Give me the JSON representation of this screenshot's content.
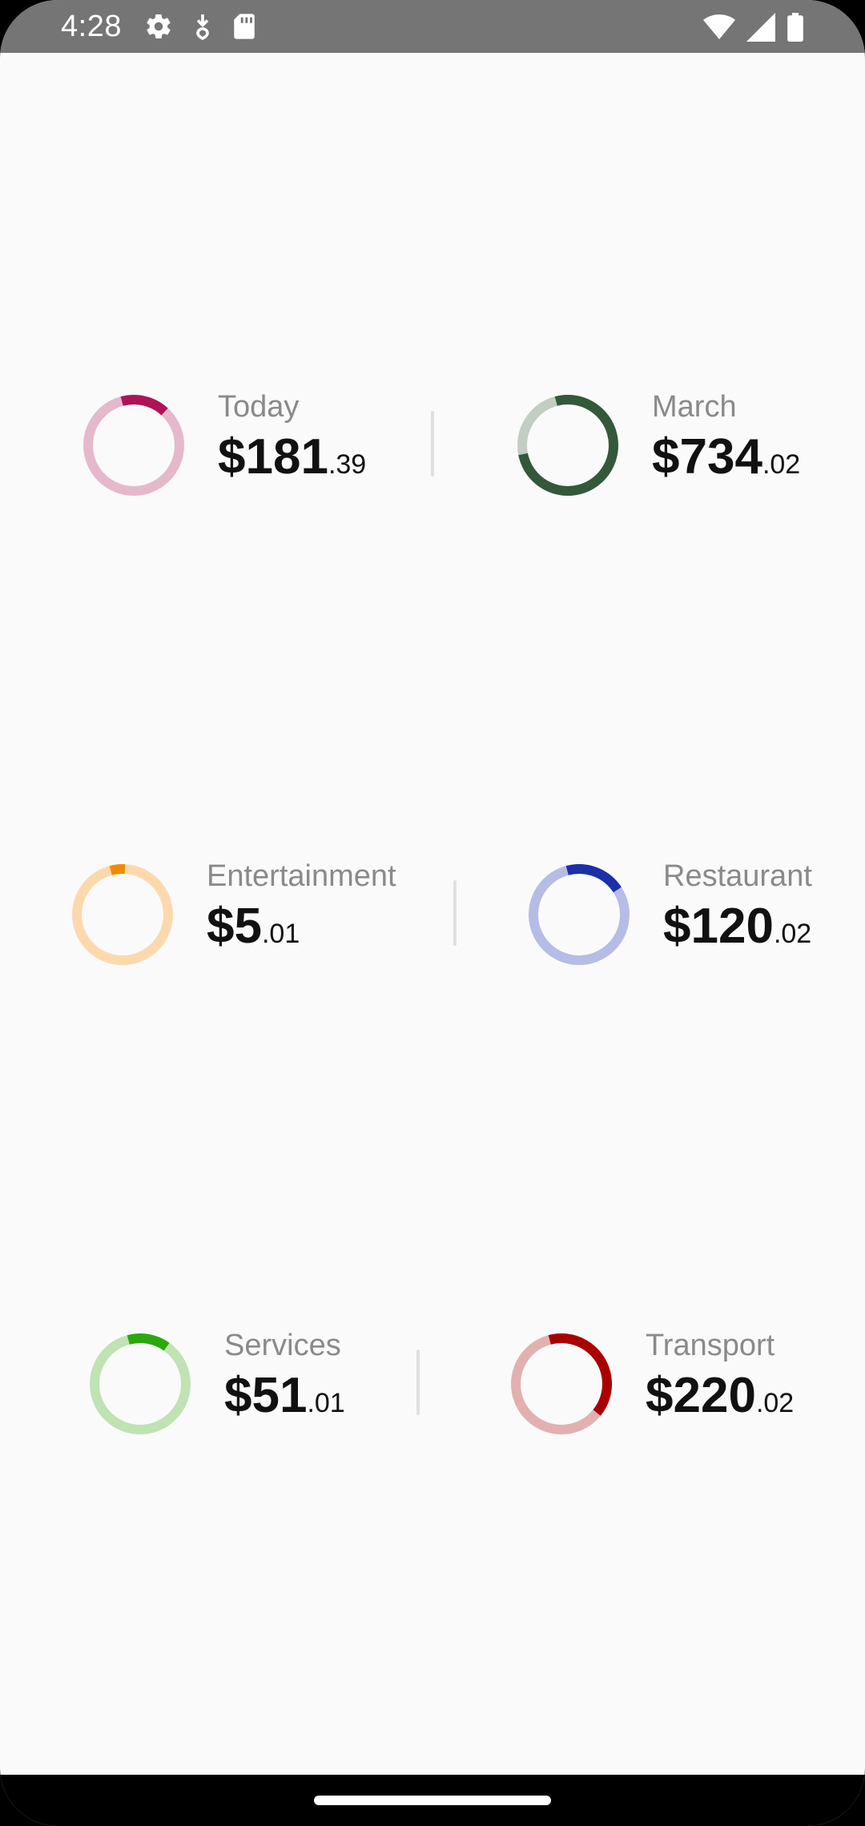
{
  "status_bar": {
    "time": "4:28",
    "icons": [
      "gear-icon",
      "download-icon",
      "sd-card-icon",
      "wifi-icon",
      "signal-icon",
      "battery-icon"
    ]
  },
  "summary": {
    "today": {
      "label": "Today",
      "whole": "$181",
      "cents": ".39",
      "fraction": 0.16,
      "color": "#ad1457",
      "track": "#e6b8cc"
    },
    "month": {
      "label": "March",
      "whole": "$734",
      "cents": ".02",
      "fraction": 0.76,
      "color": "#33593a",
      "track": "#c2cdc4"
    }
  },
  "categories": [
    {
      "label": "Entertainment",
      "whole": "$5",
      "cents": ".01",
      "fraction": 0.05,
      "color": "#f08c00",
      "track": "#fcd9ad"
    },
    {
      "label": "Restaurant",
      "whole": "$120",
      "cents": ".02",
      "fraction": 0.2,
      "color": "#1c2fa8",
      "track": "#b5bce6"
    },
    {
      "label": "Services",
      "whole": "$51",
      "cents": ".01",
      "fraction": 0.14,
      "color": "#2aa80e",
      "track": "#bfe3b3"
    },
    {
      "label": "Transport",
      "whole": "$220",
      "cents": ".02",
      "fraction": 0.4,
      "color": "#aa0000",
      "track": "#e3b0b0"
    }
  ]
}
